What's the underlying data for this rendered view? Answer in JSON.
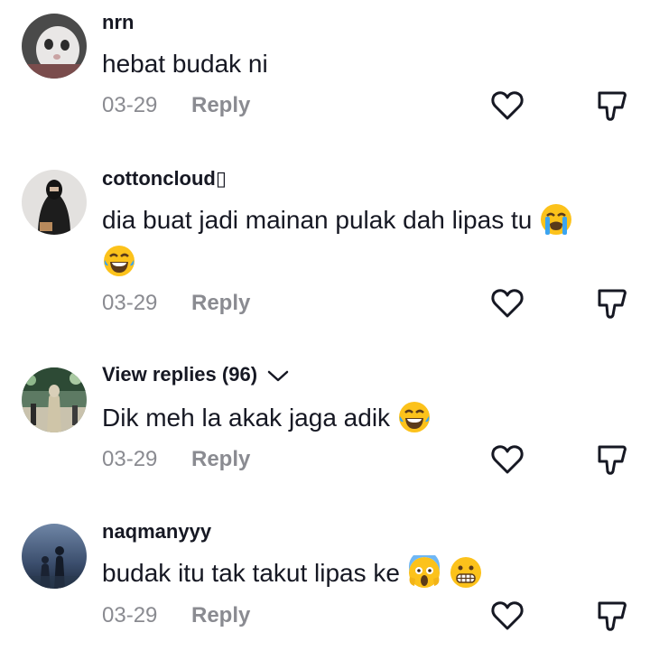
{
  "comments": [
    {
      "username": "nrn",
      "text": "hebat budak ni",
      "date": "03-29",
      "reply": "Reply"
    },
    {
      "username": "cottoncloud▯",
      "text_line1": "dia buat jadi mainan pulak dah lipas tu",
      "text_emojis": [
        "loudly-crying-face",
        "laughing-tears-face"
      ],
      "date": "03-29",
      "reply": "Reply"
    },
    {
      "username": "View replies (96)",
      "text": "Dik meh la akak jaga adik",
      "text_emojis": [
        "laughing-tears-face"
      ],
      "date": "03-29",
      "reply": "Reply"
    },
    {
      "username": "naqmanyyy",
      "text": "budak itu tak takut lipas ke",
      "text_emojis": [
        "screaming-face",
        "grimacing-face"
      ],
      "date": "03-29",
      "reply": "Reply"
    }
  ],
  "colors": {
    "text": "#161823",
    "meta": "#8a8b91",
    "icon": "#161823"
  }
}
